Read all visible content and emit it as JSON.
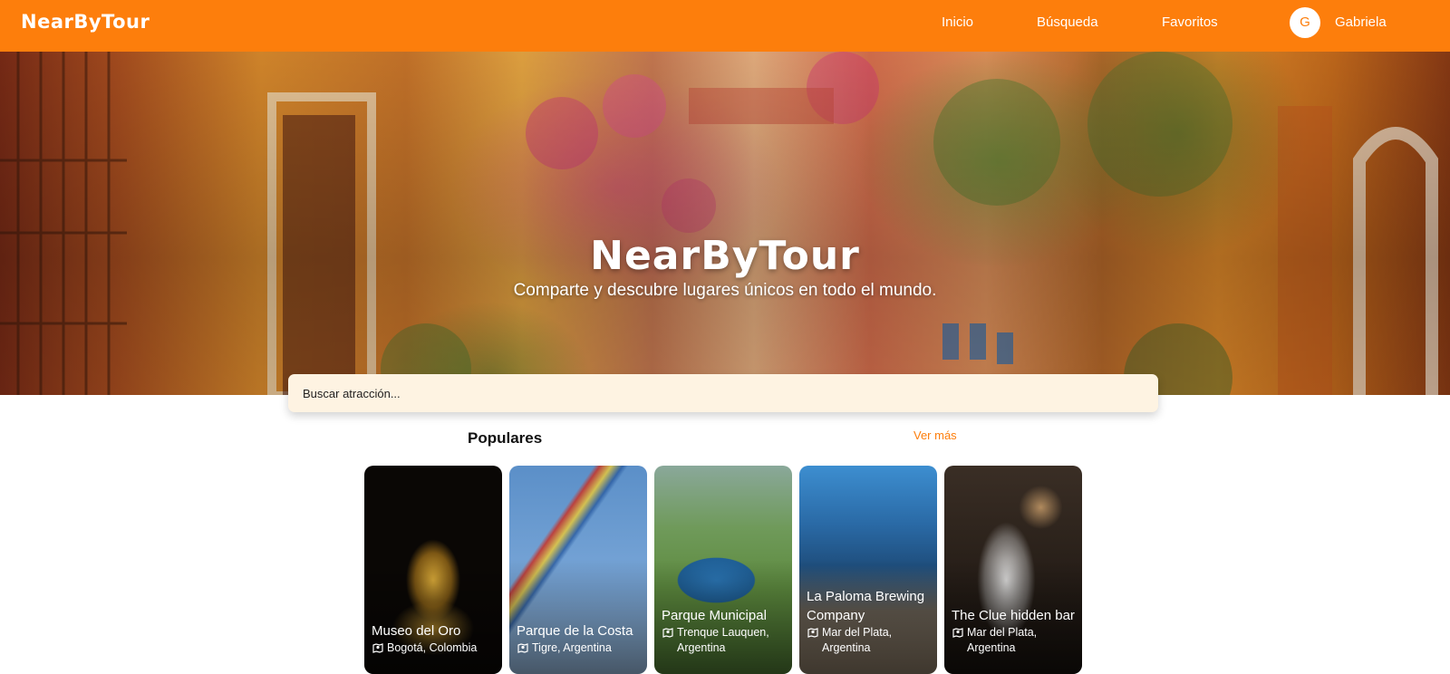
{
  "header": {
    "brand": "NearByTour",
    "nav": [
      "Inicio",
      "Búsqueda",
      "Favoritos"
    ],
    "avatar_initial": "G",
    "username": "Gabriela",
    "accent_color": "#fd7e0c"
  },
  "hero": {
    "title": "NearByTour",
    "subtitle": "Comparte y descubre lugares únicos en todo el mundo."
  },
  "search": {
    "placeholder": "Buscar atracción..."
  },
  "section": {
    "title": "Populares",
    "see_more": "Ver más"
  },
  "cards": [
    {
      "name": "Museo del Oro",
      "location": "Bogotá, Colombia"
    },
    {
      "name": "Parque de la Costa",
      "location": "Tigre, Argentina"
    },
    {
      "name": "Parque Municipal",
      "location": "Trenque Lauquen, Argentina"
    },
    {
      "name": "La Paloma Brewing Company",
      "location": "Mar del Plata, Argentina"
    },
    {
      "name": "The Clue hidden bar",
      "location": "Mar del Plata, Argentina"
    }
  ]
}
